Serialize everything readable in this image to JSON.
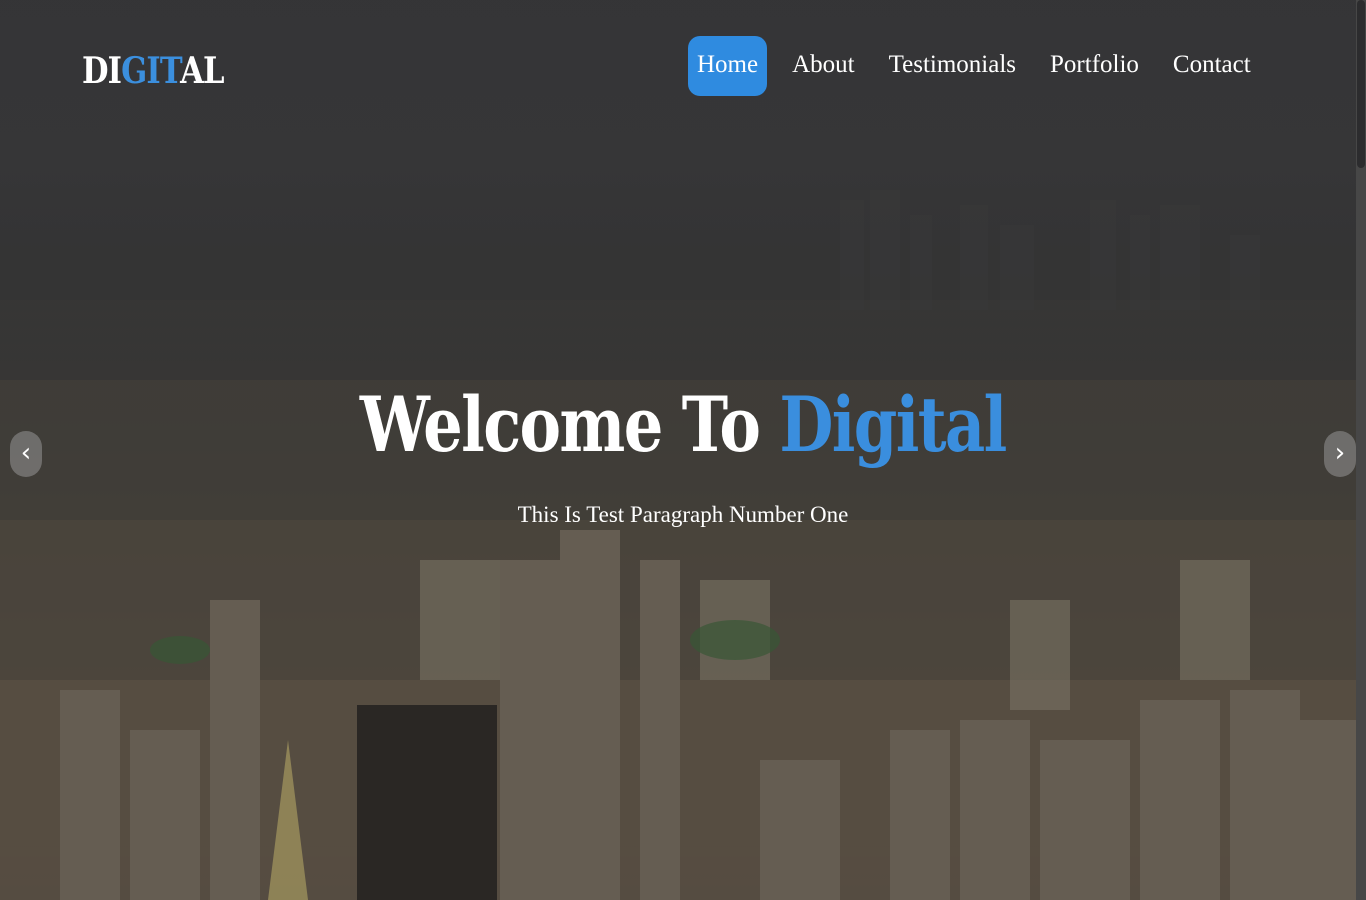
{
  "logo": {
    "part1": "DI",
    "part2": "GIT",
    "part3": "AL"
  },
  "nav": {
    "items": [
      {
        "label": "Home",
        "active": true
      },
      {
        "label": "About",
        "active": false
      },
      {
        "label": "Testimonials",
        "active": false
      },
      {
        "label": "Portfolio",
        "active": false
      },
      {
        "label": "Contact",
        "active": false
      }
    ]
  },
  "hero": {
    "headline_white": "Welcome To ",
    "headline_accent": "Digital",
    "subtitle": "This Is Test Paragraph Number One"
  },
  "carousel": {
    "prev_icon": "chevron-left-icon",
    "next_icon": "chevron-right-icon"
  },
  "colors": {
    "accent": "#2f8be0",
    "text": "#ffffff"
  }
}
